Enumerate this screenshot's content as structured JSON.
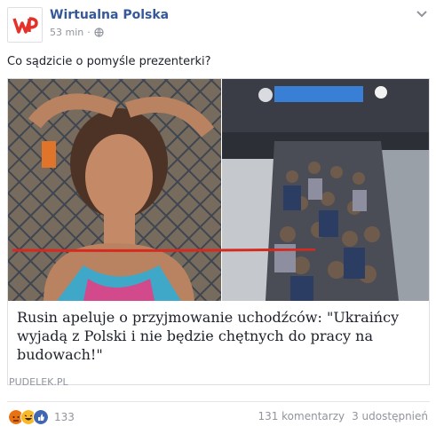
{
  "page": {
    "name": "Wirtualna Polska",
    "time": "53 min",
    "privacy_icon": "globe-icon"
  },
  "post": {
    "text": "Co sądzicie o pomyśle prezenterki?"
  },
  "card": {
    "title_highlight": "Rusin apeluje o przyjmowanie uchodźców",
    "title_rest": ": \"Ukraińcy wyjadą z Polski i nie będzie chętnych do pracy na budowach!\"",
    "domain": "PUDELEK.PL"
  },
  "footer": {
    "reaction_count": "133",
    "comments": "131 komentarzy",
    "shares": "3 udostępnień"
  },
  "colors": {
    "link": "#365899",
    "brand_red": "#e4322b",
    "underline_red": "#d62a1e"
  }
}
